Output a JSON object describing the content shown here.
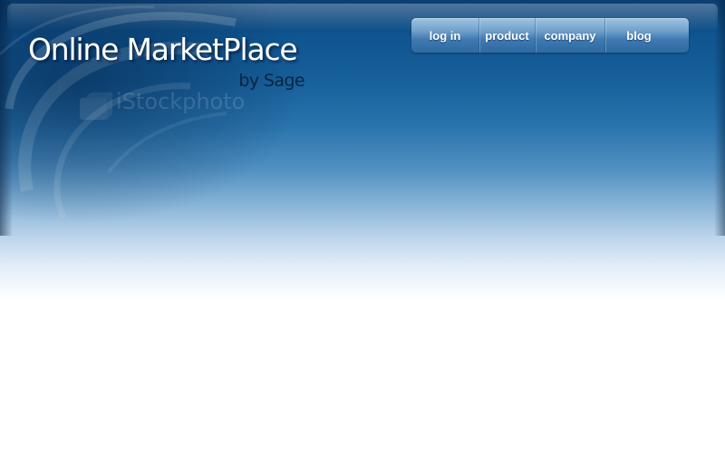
{
  "header": {
    "logo_title": "Online MarketPlace",
    "logo_subtitle": "by Sage",
    "watermark_text": "iStockphoto"
  },
  "nav": {
    "items": [
      {
        "label": "log in"
      },
      {
        "label": "product"
      },
      {
        "label": "company"
      },
      {
        "label": "blog"
      }
    ]
  },
  "colors": {
    "header_top": "#0f5590",
    "header_mid": "#2a74ad",
    "nav_highlight": "#a2c4e2",
    "nav_base": "#2e6aa3",
    "title_text": "#ffffff",
    "subtitle_text": "#0a2440",
    "page_background": "#ffffff"
  }
}
